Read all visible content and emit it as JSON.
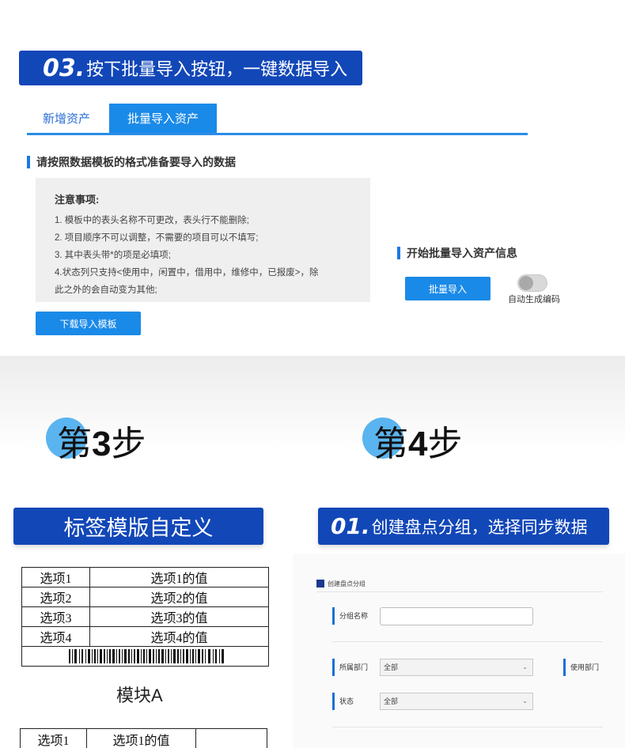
{
  "top": {
    "banner": {
      "num": "03.",
      "text": "按下批量导入按钮，一键数据导入"
    },
    "tabs": [
      {
        "label": "新增资产"
      },
      {
        "label": "批量导入资产"
      }
    ],
    "section_title": "请按照数据模板的格式准备要导入的数据",
    "notice": {
      "title": "注意事项:",
      "lines": [
        "1. 模板中的表头名称不可更改，表头行不能删除;",
        "2. 项目顺序不可以调整，不需要的项目可以不填写;",
        "3. 其中表头带*的项是必填项;",
        "4.状态列只支持<使用中，闲置中，借用中，维修中，已报废>，除",
        "此之外的会自动变为其他;"
      ]
    },
    "download_button": "下载导入模板",
    "import_section_title": "开始批量导入资产信息",
    "import_button": "批量导入",
    "auto_code_label": "自动生成编码"
  },
  "steps": {
    "step3": {
      "prefix": "第",
      "num": "3",
      "suffix": "步"
    },
    "step4": {
      "prefix": "第",
      "num": "4",
      "suffix": "步"
    }
  },
  "left": {
    "banner": "标签模版自定义",
    "table": [
      {
        "k": "选项1",
        "v": "选项1的值"
      },
      {
        "k": "选项2",
        "v": "选项2的值"
      },
      {
        "k": "选项3",
        "v": "选项3的值"
      },
      {
        "k": "选项4",
        "v": "选项4的值"
      }
    ],
    "module_label": "模块A",
    "table2": [
      {
        "k": "选项1",
        "v": "选项1的值",
        "extra": ""
      }
    ]
  },
  "right": {
    "banner": {
      "num": "01.",
      "text": "创建盘点分组，选择同步数据"
    },
    "form_title": "创建盘点分组",
    "group_name_label": "分组名称",
    "group_name_value": "",
    "dept_label": "所属部门",
    "dept_value": "全部",
    "use_dept_label": "使用部门",
    "status_label": "状态",
    "status_value": "全部"
  },
  "colors": {
    "banner": "#1247b8",
    "accent": "#1a8ae8",
    "step_dot": "#5ab4ef"
  }
}
